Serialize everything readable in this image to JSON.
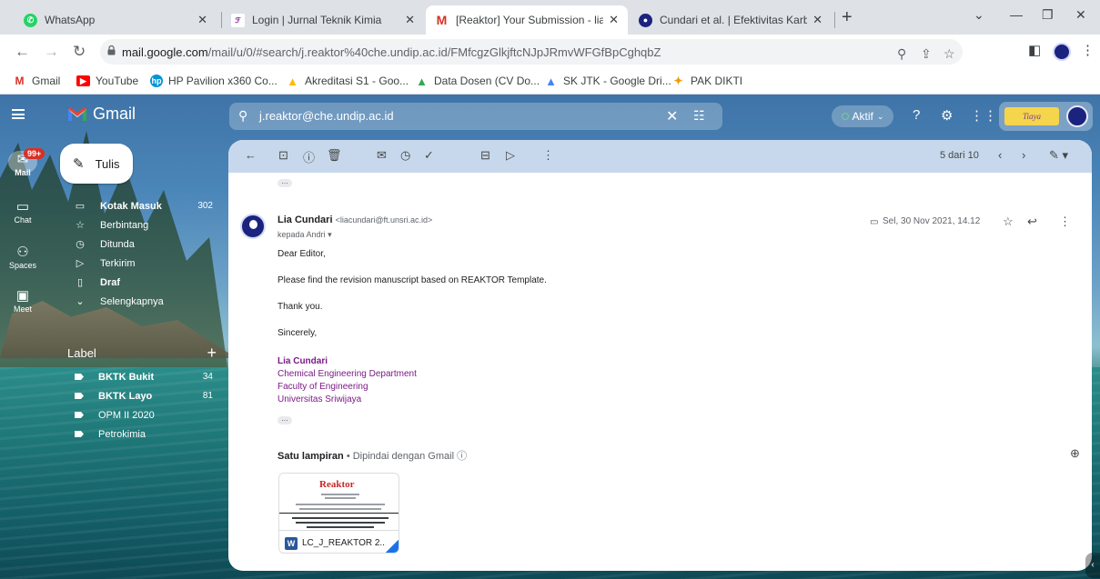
{
  "browser": {
    "tabs": [
      {
        "title": "WhatsApp",
        "active": false
      },
      {
        "title": "Login | Jurnal Teknik Kimia",
        "active": false
      },
      {
        "title": "[Reaktor] Your Submission - liacu",
        "active": true
      },
      {
        "title": "Cundari et al. | Efektivitas Karbon",
        "active": false
      }
    ],
    "url_host": "mail.google.com",
    "url_path": "/mail/u/0/#search/j.reaktor%40che.undip.ac.id/FMfcgzGlkjftcNJpJRmvWFGfBpCghqbZ",
    "bookmarks": [
      "Gmail",
      "YouTube",
      "HP Pavilion x360 Co...",
      "Akreditasi S1 - Goo...",
      "Data Dosen (CV Do...",
      "SK JTK - Google Dri...",
      "PAK DIKTI"
    ]
  },
  "gmail": {
    "logo_text": "Gmail",
    "search_query": "j.reaktor@che.undip.ac.id",
    "status_label": "Aktif",
    "account_brand": "Tiaya",
    "rail": {
      "mail_badge": "99+",
      "items": [
        "Mail",
        "Chat",
        "Spaces",
        "Meet"
      ]
    },
    "compose_label": "Tulis",
    "nav": [
      {
        "label": "Kotak Masuk",
        "count": "302",
        "bold": true
      },
      {
        "label": "Berbintang",
        "count": "",
        "bold": false
      },
      {
        "label": "Ditunda",
        "count": "",
        "bold": false
      },
      {
        "label": "Terkirim",
        "count": "",
        "bold": false
      },
      {
        "label": "Draf",
        "count": "",
        "bold": true
      },
      {
        "label": "Selengkapnya",
        "count": "",
        "bold": false
      }
    ],
    "labels_heading": "Label",
    "labels": [
      {
        "label": "BKTK Bukit",
        "count": "34",
        "bold": true
      },
      {
        "label": "BKTK Layo",
        "count": "81",
        "bold": true
      },
      {
        "label": "OPM II 2020",
        "count": "",
        "bold": false
      },
      {
        "label": "Petrokimia",
        "count": "",
        "bold": false
      }
    ],
    "pager": "5 dari 10"
  },
  "message": {
    "sender_name": "Lia Cundari",
    "sender_email": "<liacundari@ft.unsri.ac.id>",
    "to_line": "kepada Andri",
    "date": "Sel, 30 Nov 2021, 14.12",
    "body": [
      "Dear Editor,",
      "Please find the revision manuscript based on REAKTOR Template.",
      "Thank you.",
      "Sincerely,"
    ],
    "signature_name": "Lia Cundari",
    "signature_lines": [
      "Chemical Engineering Department",
      "Faculty of Engineering",
      "Universitas Sriwijaya"
    ],
    "attachment_heading": "Satu lampiran",
    "attachment_scan_note": "Dipindai dengan Gmail",
    "attachment_preview_title": "Reaktor",
    "attachment_filename": "LC_J_REAKTOR 2..."
  }
}
